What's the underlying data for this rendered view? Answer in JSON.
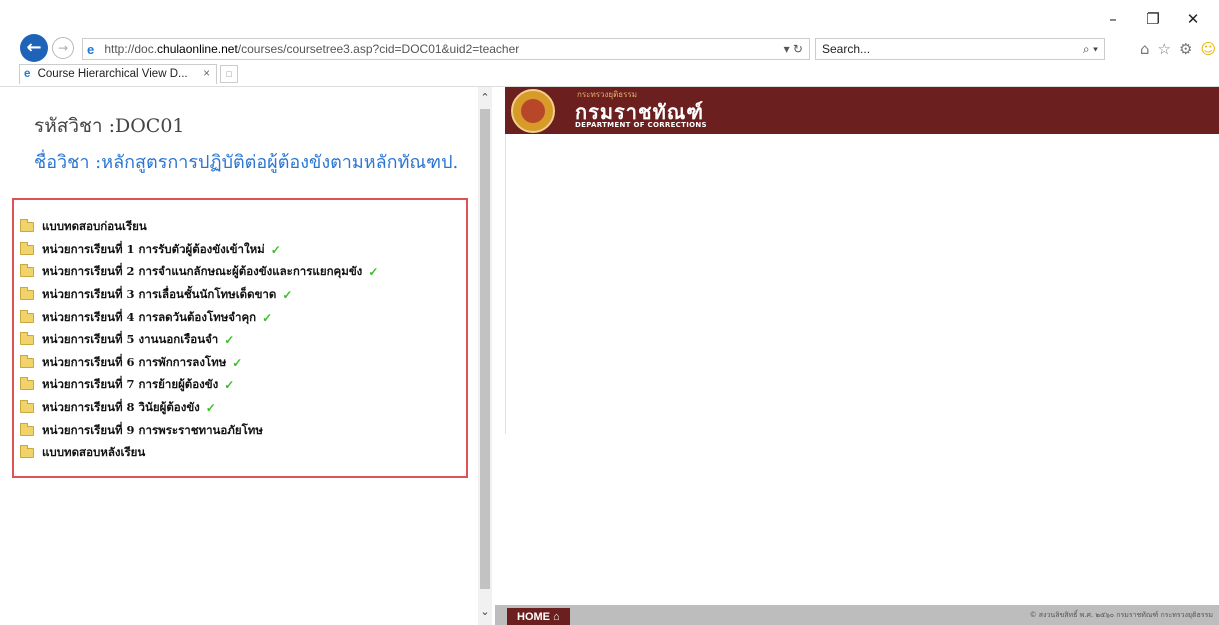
{
  "window": {
    "minimize": "–",
    "restore": "❐",
    "close": "✕"
  },
  "address_bar": {
    "url_prefix": "http://doc.",
    "url_host": "chulaonline.net",
    "url_suffix": "/courses/coursetree3.asp?cid=DOC01&uid2=teacher",
    "url_tools": "▾ ↻",
    "search_placeholder": "Search...",
    "search_icon": "⌕ ▾"
  },
  "toolbar_icons": {
    "home": "⌂",
    "favorites": "☆",
    "settings": "⚙",
    "feedback": "☺"
  },
  "tab": {
    "title": "Course Hierarchical View D...",
    "close": "×"
  },
  "left": {
    "course_code": "รหัสวิชา :DOC01",
    "course_name": "ชื่อวิชา :หลักสูตรการปฏิบัติต่อผู้ต้องขังตามหลักทัณฑป.",
    "items": [
      {
        "label": "แบบทดสอบก่อนเรียน",
        "check": ""
      },
      {
        "label": "หน่วยการเรียนที่ 1 การรับตัวผู้ต้องขังเข้าใหม่",
        "check": "✓"
      },
      {
        "label": "หน่วยการเรียนที่ 2 การจำแนกลักษณะผู้ต้องขังและการแยกคุมขัง",
        "check": "✓"
      },
      {
        "label": "หน่วยการเรียนที่ 3 การเลื่อนชั้นนักโทษเด็ดขาด",
        "check": "✓"
      },
      {
        "label": "หน่วยการเรียนที่ 4 การลดวันต้องโทษจำคุก",
        "check": "✓"
      },
      {
        "label": "หน่วยการเรียนที่ 5 งานนอกเรือนจำ",
        "check": "✓"
      },
      {
        "label": "หน่วยการเรียนที่ 6 การพักการลงโทษ",
        "check": "✓"
      },
      {
        "label": "หน่วยการเรียนที่ 7 การย้ายผู้ต้องขัง",
        "check": "✓"
      },
      {
        "label": "หน่วยการเรียนที่ 8 วินัยผู้ต้องขัง",
        "check": "✓"
      },
      {
        "label": "หน่วยการเรียนที่ 9 การพระราชทานอภัยโทษ",
        "check": ""
      },
      {
        "label": "แบบทดสอบหลังเรียน",
        "check": ""
      }
    ]
  },
  "banner": {
    "ministry": "กระทรวงยุติธรรม",
    "dept_thai": "กรมราชทัณฑ์",
    "dept_en": "DEPARTMENT OF CORRECTIONS"
  },
  "bottom": {
    "home_label": "HOME ⌂",
    "copyright": "© สงวนลิขสิทธิ์ พ.ศ. ๒๕๖๐ กรมราชทัณฑ์ กระทรวงยุติธรรม"
  },
  "colors": {
    "banner": "#6b1f1f",
    "course_name": "#2a76d2",
    "highlight_box": "#e05252",
    "check": "#3cbf2a"
  }
}
